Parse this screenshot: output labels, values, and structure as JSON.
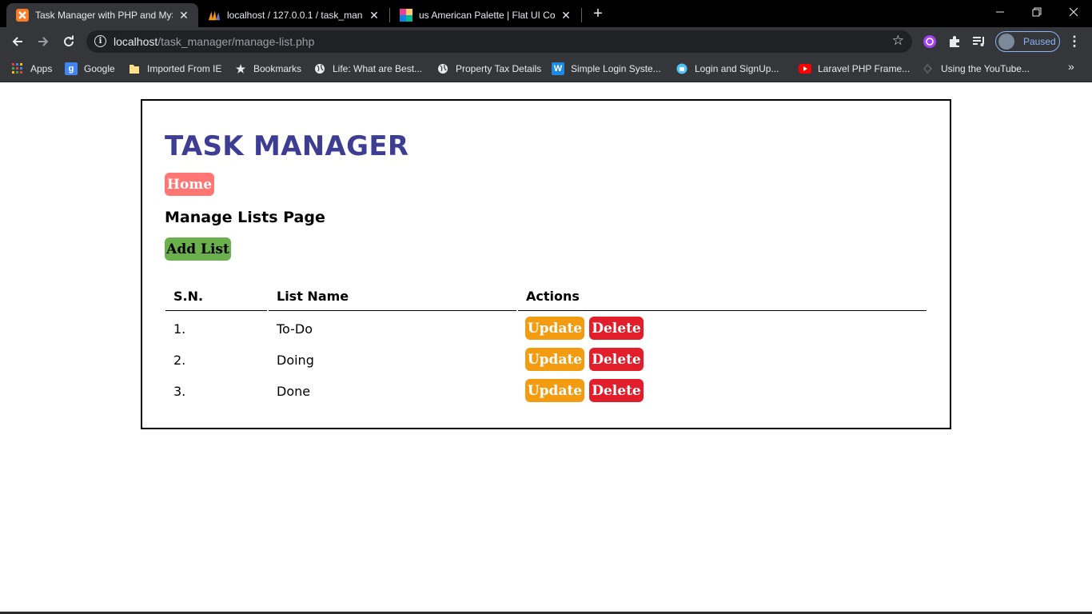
{
  "browser": {
    "tabs": [
      {
        "title": "Task Manager with PHP and MyS",
        "active": true,
        "icon": "xampp-icon"
      },
      {
        "title": "localhost / 127.0.0.1 / task_mana",
        "active": false,
        "icon": "phpmyadmin-icon"
      },
      {
        "title": "us American Palette | Flat UI Colo",
        "active": false,
        "icon": "flatuicolors-icon"
      }
    ],
    "url_host": "localhost",
    "url_path": "/task_manager/manage-list.php",
    "profile_status": "Paused",
    "bookmarks": [
      {
        "label": "Apps",
        "icon": "apps-grid-icon"
      },
      {
        "label": "Google",
        "icon": "google-icon"
      },
      {
        "label": "Imported From IE",
        "icon": "folder-icon"
      },
      {
        "label": "Bookmarks",
        "icon": "star-icon"
      },
      {
        "label": "Life: What are Best...",
        "icon": "globe-icon"
      },
      {
        "label": "Property Tax Details",
        "icon": "globe-icon"
      },
      {
        "label": "Simple Login Syste...",
        "icon": "w-icon"
      },
      {
        "label": "Login and SignUp...",
        "icon": "android-icon"
      },
      {
        "label": "Laravel PHP Frame...",
        "icon": "youtube-icon"
      },
      {
        "label": "Using the YouTube...",
        "icon": "code-icon"
      }
    ]
  },
  "page": {
    "title": "TASK MANAGER",
    "home_label": "Home",
    "heading": "Manage Lists Page",
    "add_label": "Add List",
    "table": {
      "headers": [
        "S.N.",
        "List Name",
        "Actions"
      ],
      "rows": [
        {
          "sn": "1.",
          "name": "To-Do"
        },
        {
          "sn": "2.",
          "name": "Doing"
        },
        {
          "sn": "3.",
          "name": "Done"
        }
      ],
      "update_label": "Update",
      "delete_label": "Delete"
    }
  },
  "colors": {
    "title": "#3d3d94",
    "home": "#ff7675",
    "add": "#6ab04c",
    "update": "#f39c12",
    "delete": "#e31e2b"
  }
}
